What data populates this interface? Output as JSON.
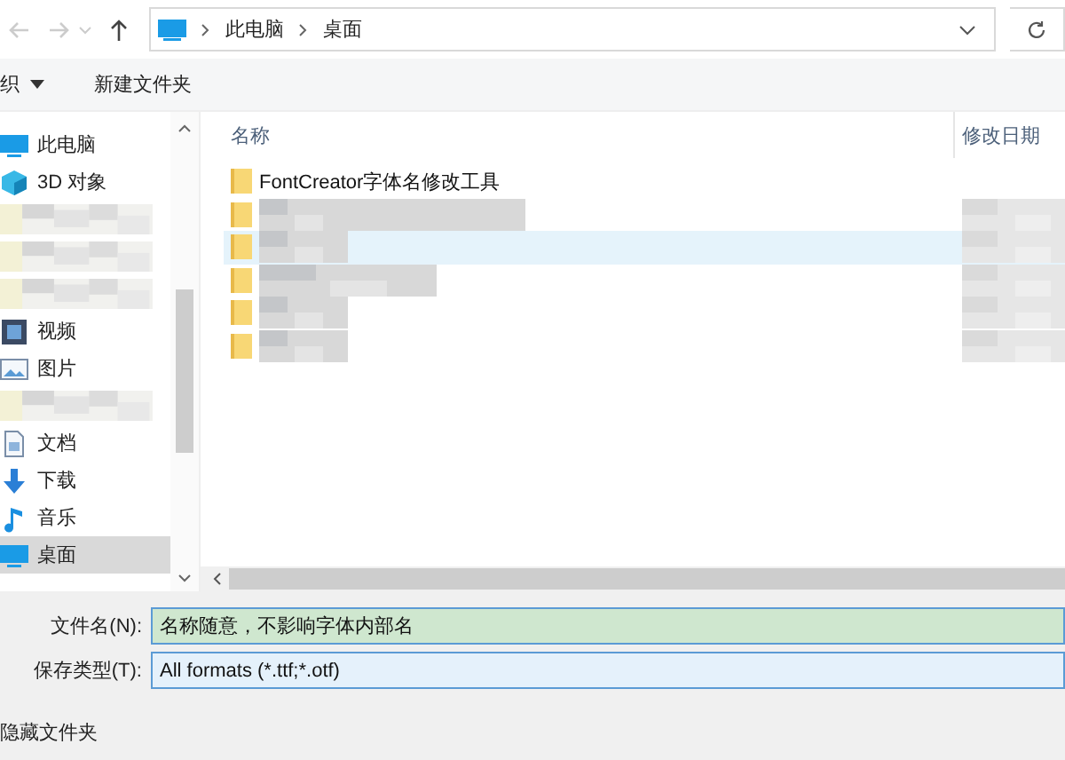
{
  "address": {
    "crumbs": [
      "此电脑",
      "桌面"
    ]
  },
  "toolbar": [
    {
      "kind": "menu",
      "label": "织"
    },
    {
      "kind": "button",
      "label": "新建文件夹"
    }
  ],
  "sidebar": {
    "items": [
      {
        "kind": "computer",
        "label": "此电脑",
        "selected": false
      },
      {
        "kind": "cube",
        "label": "3D 对象",
        "selected": false
      },
      {
        "kind": "blurred",
        "selected": false
      },
      {
        "kind": "blurred",
        "selected": false
      },
      {
        "kind": "blurred",
        "selected": false
      },
      {
        "kind": "video",
        "label": "视频",
        "selected": false
      },
      {
        "kind": "picture",
        "label": "图片",
        "selected": false
      },
      {
        "kind": "blurred",
        "selected": false
      },
      {
        "kind": "document",
        "label": "文档",
        "selected": false
      },
      {
        "kind": "download",
        "label": "下载",
        "selected": false
      },
      {
        "kind": "music",
        "label": "音乐",
        "selected": false
      },
      {
        "kind": "desktop",
        "label": "桌面",
        "selected": true
      }
    ]
  },
  "files": {
    "columns": [
      "名称",
      "修改日期"
    ],
    "rows": [
      {
        "kind": "folder",
        "name": "FontCreator字体名修改工具",
        "hovered": false
      },
      {
        "kind": "blurred",
        "hovered": false
      },
      {
        "kind": "blurred",
        "hovered": true
      },
      {
        "kind": "blurred",
        "hovered": false
      },
      {
        "kind": "blurred",
        "hovered": false
      },
      {
        "kind": "blurred",
        "hovered": false
      }
    ]
  },
  "form": {
    "filename": {
      "label": "文件名(N):",
      "value": "名称随意，不影响字体内部名"
    },
    "type": {
      "label": "保存类型(T):",
      "value": "All formats (*.ttf;*.otf)"
    },
    "hidden_folders": "隐藏文件夹"
  }
}
